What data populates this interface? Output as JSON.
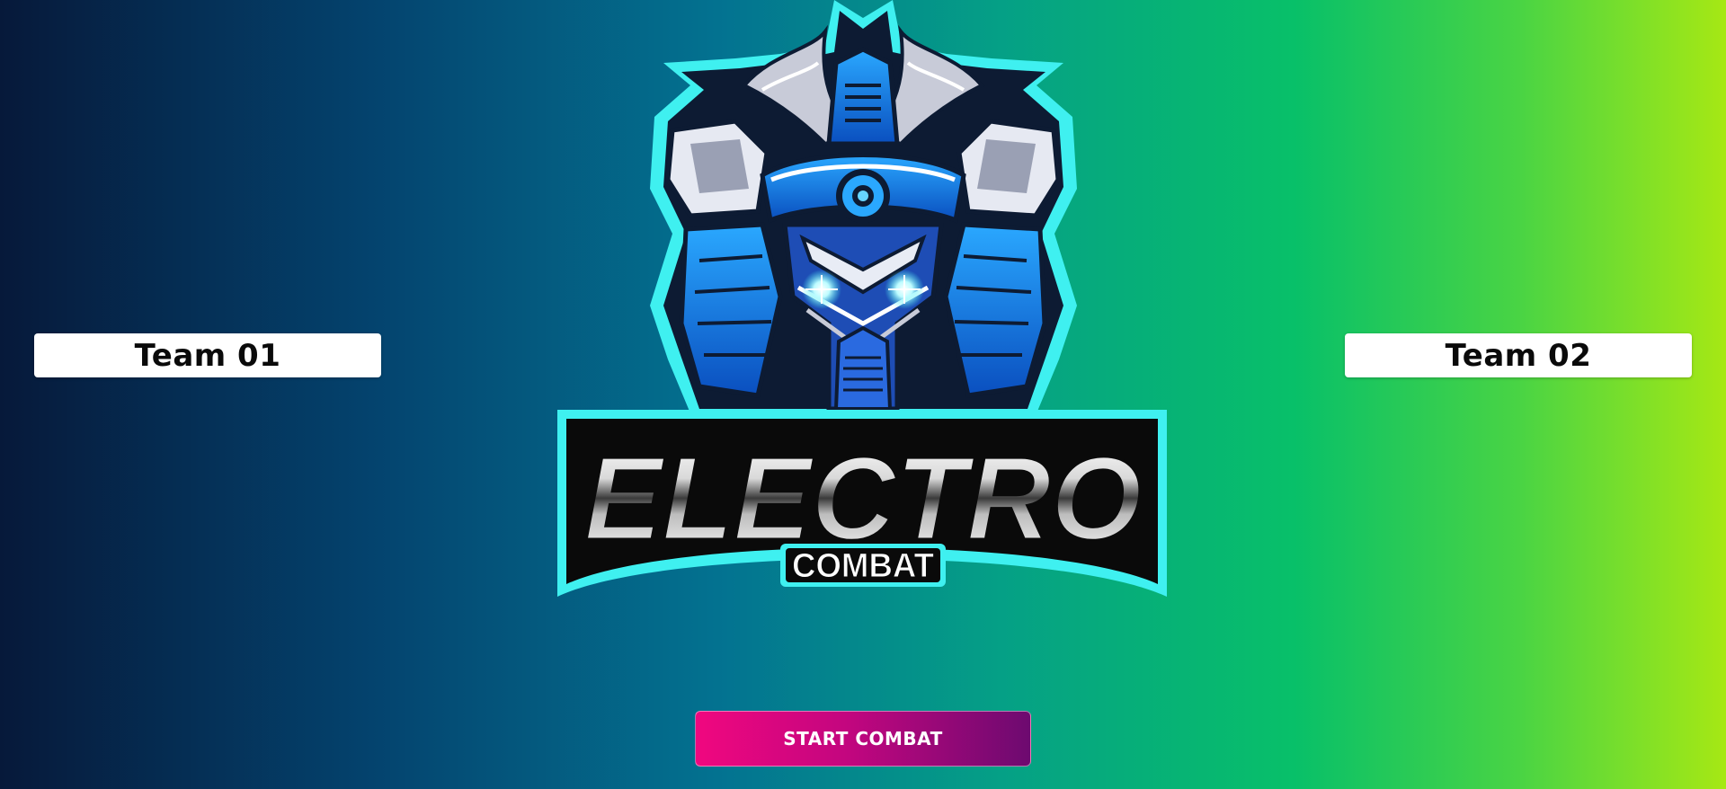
{
  "teams": {
    "team_one_label": "Team 01",
    "team_two_label": "Team 02"
  },
  "logo": {
    "title_main": "ELECTRO",
    "title_sub": "COMBAT",
    "emblem": "samurai-robot-mascot"
  },
  "actions": {
    "start_label": "START COMBAT"
  },
  "colors": {
    "background_start": "#06193a",
    "background_mid": "#037391",
    "background_end": "#a6e814",
    "accent_cyan": "#3ff0f0",
    "button_start": "#f0077f",
    "button_end": "#6d0a70"
  }
}
